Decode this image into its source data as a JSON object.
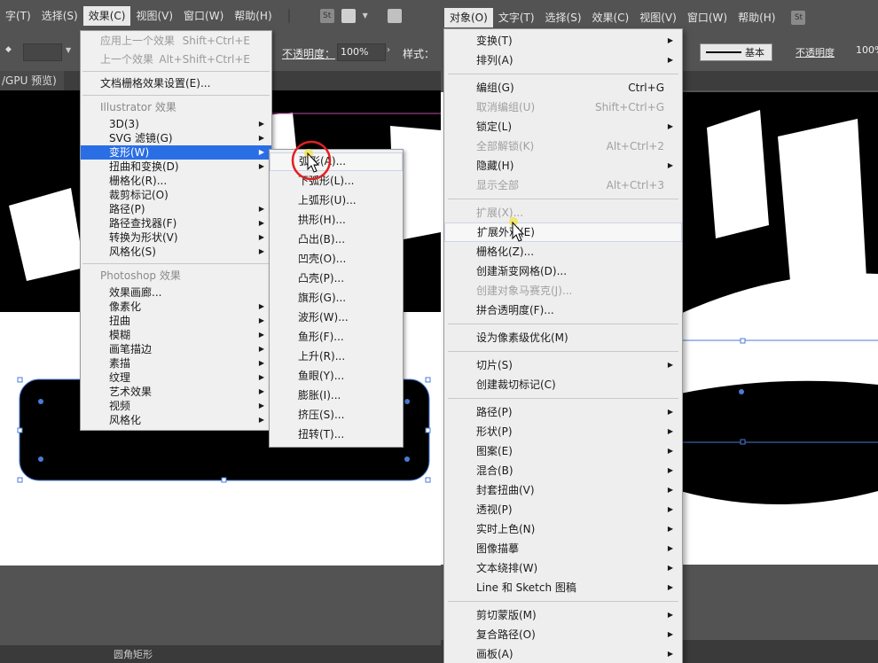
{
  "left": {
    "menubar": [
      "字(T)",
      "选择(S)",
      "效果(C)",
      "视图(V)",
      "窗口(W)",
      "帮助(H)"
    ],
    "menubar_badge": "St",
    "opacity_label": "不透明度：",
    "opacity_value": "100%",
    "style_label": "样式：",
    "tab_label": "/GPU 预览)",
    "status_text": "圆角矩形",
    "effect_menu": {
      "apply_last": "应用上一个效果",
      "apply_last_shortcut": "Shift+Ctrl+E",
      "last_effect": "上一个效果",
      "last_effect_shortcut": "Alt+Shift+Ctrl+E",
      "doc_raster": "文档栅格效果设置(E)...",
      "illustrator_header": "Illustrator 效果",
      "illustrator_items": [
        "3D(3)",
        "SVG 滤镜(G)",
        "变形(W)",
        "扭曲和变换(D)",
        "栅格化(R)...",
        "裁剪标记(O)",
        "路径(P)",
        "路径查找器(F)",
        "转换为形状(V)",
        "风格化(S)"
      ],
      "photoshop_header": "Photoshop 效果",
      "photoshop_items": [
        "效果画廊...",
        "像素化",
        "扭曲",
        "模糊",
        "画笔描边",
        "素描",
        "纹理",
        "艺术效果",
        "视频",
        "风格化"
      ]
    },
    "warp_submenu": [
      "弧形(A)...",
      "下弧形(L)...",
      "上弧形(U)...",
      "拱形(H)...",
      "凸出(B)...",
      "凹壳(O)...",
      "凸壳(P)...",
      "旗形(G)...",
      "波形(W)...",
      "鱼形(F)...",
      "上升(R)...",
      "鱼眼(Y)...",
      "膨胀(I)...",
      "挤压(S)...",
      "扭转(T)..."
    ]
  },
  "right": {
    "menubar": [
      "对象(O)",
      "文字(T)",
      "选择(S)",
      "效果(C)",
      "视图(V)",
      "窗口(W)",
      "帮助(H)"
    ],
    "menubar_badge": "St",
    "opacity_label": "不透明度",
    "opacity_value": "100%",
    "basic_label": "基本",
    "object_menu": {
      "transform": "变换(T)",
      "arrange": "排列(A)",
      "group": "编组(G)",
      "group_shortcut": "Ctrl+G",
      "ungroup": "取消编组(U)",
      "ungroup_shortcut": "Shift+Ctrl+G",
      "lock": "锁定(L)",
      "unlock_all": "全部解锁(K)",
      "unlock_all_shortcut": "Alt+Ctrl+2",
      "hide": "隐藏(H)",
      "show_all": "显示全部",
      "show_all_shortcut": "Alt+Ctrl+3",
      "expand": "扩展(X)...",
      "expand_appearance": "扩展外观(E)",
      "rasterize": "栅格化(Z)...",
      "gradient_mesh": "创建渐变网格(D)...",
      "object_mosaic": "创建对象马赛克(J)...",
      "flatten_transparency": "拼合透明度(F)...",
      "pixel_perfect": "设为像素级优化(M)",
      "slice": "切片(S)",
      "trim_marks": "创建裁切标记(C)",
      "path": "路径(P)",
      "shape": "形状(P)",
      "pattern": "图案(E)",
      "blend": "混合(B)",
      "envelope": "封套扭曲(V)",
      "perspective": "透视(P)",
      "live_paint": "实时上色(N)",
      "image_trace": "图像描摹",
      "text_wrap": "文本绕排(W)",
      "line_sketch": "Line 和 Sketch 图稿",
      "clipping_mask": "剪切蒙版(M)",
      "compound_path": "复合路径(O)",
      "artboards": "画板(A)"
    }
  }
}
